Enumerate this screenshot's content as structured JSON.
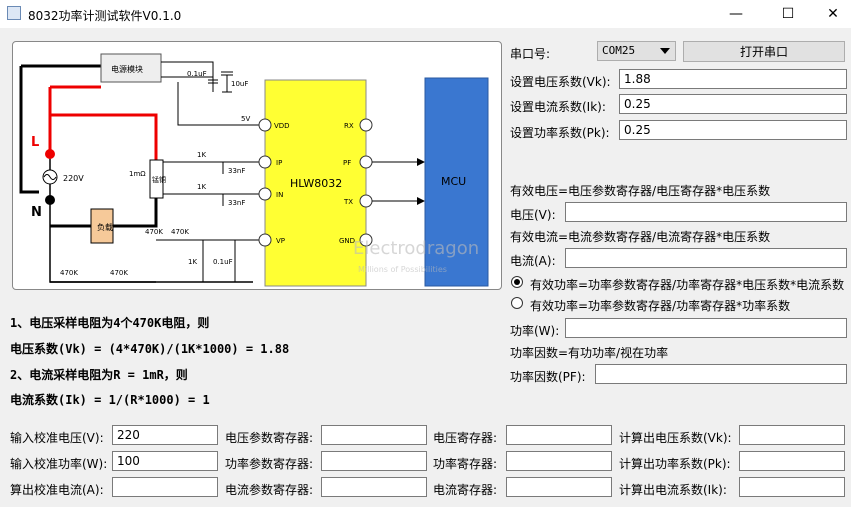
{
  "window": {
    "title": "8032功率计测试软件V0.1.0",
    "minimize": "—",
    "maximize": "☐",
    "close": "✕"
  },
  "serial": {
    "label": "串口号:",
    "port": "COM25",
    "open_button": "打开串口"
  },
  "coefficients": [
    {
      "label": "设置电压系数(Vk):",
      "value": "1.88"
    },
    {
      "label": "设置电流系数(Ik):",
      "value": "0.25"
    },
    {
      "label": "设置功率系数(Pk):",
      "value": "0.25"
    }
  ],
  "measure": {
    "voltage_formula": "有效电压=电压参数寄存器/电压寄存器*电压系数",
    "voltage_label": "电压(V):",
    "voltage_value": "",
    "current_formula": "有效电流=电流参数寄存器/电流寄存器*电压系数",
    "current_label": "电流(A):",
    "current_value": "",
    "power_option1": "有效功率=功率参数寄存器/功率寄存器*电压系数*电流系数",
    "power_option2": "有效功率=功率参数寄存器/功率寄存器*功率系数",
    "power_option_selected": 1,
    "power_label": "功率(W):",
    "power_value": "",
    "pf_formula": "功率因数=有功功率/视在功率",
    "pf_label": "功率因数(PF):",
    "pf_value": ""
  },
  "notes": {
    "line1": "1、电压采样电阻为4个470K电阻，则",
    "line2": "电压系数(Vk) = (4*470K)/(1K*1000) = 1.88",
    "line3": "2、电流采样电阻为R = 1mR，则",
    "line4": "电流系数(Ik) = 1/(R*1000) = 1"
  },
  "calib": {
    "rows": [
      {
        "label": "输入校准电压(V):",
        "value": "220",
        "reg1_label": "电压参数寄存器:",
        "reg1_value": "",
        "reg2_label": "电压寄存器:",
        "reg2_value": "",
        "result_label": "计算出电压系数(Vk):",
        "result_value": ""
      },
      {
        "label": "输入校准功率(W):",
        "value": "100",
        "reg1_label": "功率参数寄存器:",
        "reg1_value": "",
        "reg2_label": "功率寄存器:",
        "reg2_value": "",
        "result_label": "计算出功率系数(Pk):",
        "result_value": ""
      },
      {
        "label": "算出校准电流(A):",
        "value": "",
        "reg1_label": "电流参数寄存器:",
        "reg1_value": "",
        "reg2_label": "电流寄存器:",
        "reg2_value": "",
        "result_label": "计算出电流系数(Ik):",
        "result_value": ""
      }
    ]
  },
  "schematic": {
    "power_module": "电源模块",
    "chip": "HLW8032",
    "mcu": "MCU",
    "pin_vdd": "VDD",
    "pin_ip": "IP",
    "pin_in": "IN",
    "pin_vp": "VP",
    "pin_rx": "RX",
    "pin_pf": "PF",
    "pin_tx": "TX",
    "pin_gnd": "GND",
    "cap1": "0.1uF",
    "cap2": "10uF",
    "v5": "5V",
    "r1k_a": "1K",
    "r1k_b": "1K",
    "r1k_c": "1K",
    "c33_a": "33nF",
    "c33_b": "33nF",
    "c01": "0.1uF",
    "r470_a": "470K",
    "r470_b": "470K",
    "r470_c": "470K",
    "r470_d": "470K",
    "shunt": "1mΩ",
    "shunt_label": "锰铜",
    "load": "负载",
    "mains": "220V",
    "L": "L",
    "N": "N",
    "watermark": "Electrodragon",
    "watermark_sub": "Millions of Possibilities"
  }
}
